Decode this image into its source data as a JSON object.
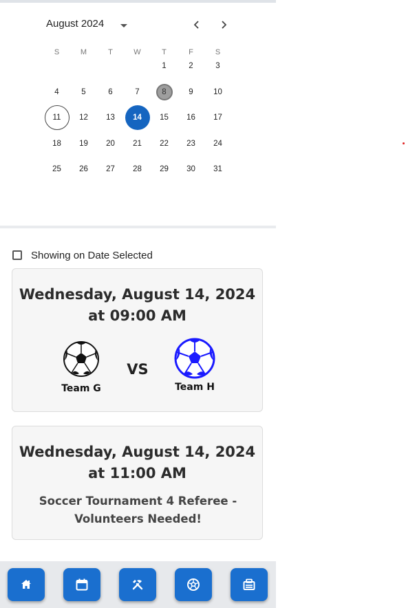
{
  "calendar": {
    "month_label": "August 2024",
    "weekdays": [
      "S",
      "M",
      "T",
      "W",
      "T",
      "F",
      "S"
    ],
    "weeks": [
      [
        "",
        "",
        "",
        "",
        "1",
        "2",
        "3"
      ],
      [
        "4",
        "5",
        "6",
        "7",
        "8",
        "9",
        "10"
      ],
      [
        "11",
        "12",
        "13",
        "14",
        "15",
        "16",
        "17"
      ],
      [
        "18",
        "19",
        "20",
        "21",
        "22",
        "23",
        "24"
      ],
      [
        "25",
        "26",
        "27",
        "28",
        "29",
        "30",
        "31"
      ]
    ],
    "today": "11",
    "selected": "14",
    "highlighted": "8"
  },
  "filter": {
    "label": "Showing on Date Selected",
    "checked": false
  },
  "events": [
    {
      "date": "Wednesday, August 14, 2024",
      "time": "at 09:00 AM",
      "home_team": "Team G",
      "away_team": "Team H",
      "vs": "VS"
    },
    {
      "date": "Wednesday, August 14, 2024",
      "time": "at 11:00 AM",
      "description": "Soccer Tournament 4 Referee - Volunteers Needed!"
    }
  ],
  "bottom_nav": [
    {
      "icon": "home-icon"
    },
    {
      "icon": "calendar-icon"
    },
    {
      "icon": "tools-icon"
    },
    {
      "icon": "soccer-ball-icon"
    },
    {
      "icon": "id-card-icon"
    }
  ],
  "colors": {
    "accent": "#1a6fcf",
    "selected_day": "#1565c0",
    "away_team_ball": "#1a1aff"
  }
}
